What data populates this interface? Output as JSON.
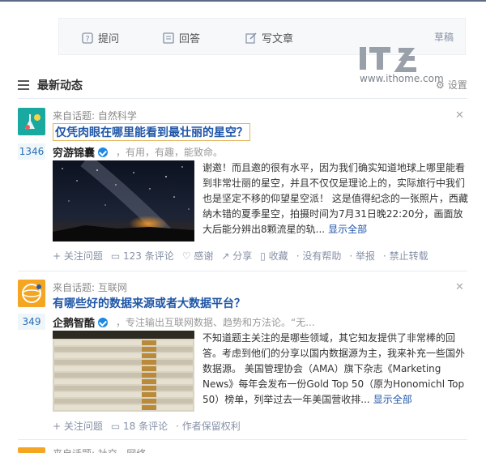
{
  "actionbar": {
    "ask_label": "提问",
    "answer_label": "回答",
    "write_label": "写文章",
    "draft_label": "草稿"
  },
  "watermark": {
    "logo": "IT之家",
    "url": "www.ithome.com"
  },
  "feed": {
    "title": "最新动态",
    "settings_label": "设置"
  },
  "items": [
    {
      "from": "来自话题: 自然科学",
      "title": "仅凭肉眼在哪里能看到最壮丽的星空？",
      "votes": "1346",
      "author": "穷游锦囊",
      "bio": "，有用，有趣，能致命。",
      "excerpt": "谢邀！而且邀的很有水平，因为我们确实知道地球上哪里能看到非常壮丽的星空，并且不仅仅是理论上的，实际旅行中我们也是坚定不移的仰望星空派！ 这是值得纪念的一张照片，西藏纳木错的夏季星空，拍摄时间为7月31日晚22:20分，画面放大后能分辨出8颗流星的轨...",
      "more": "显示全部",
      "actions": [
        "+ 关注问题",
        "123 条评论",
        "感谢",
        "分享",
        "收藏",
        "· 没有帮助",
        "· 举报",
        "· 禁止转载"
      ]
    },
    {
      "from": "来自话题: 互联网",
      "title": "有哪些好的数据来源或者大数据平台？",
      "votes": "349",
      "author": "企鹅智酷",
      "bio": "，专注输出互联网数据、趋势和方法论。“无...",
      "excerpt": "不知道题主关注的是哪些领域，其它知友提供了非常棒的回答。考虑到他们的分享以国内数据源为主，我来补充一些国外数据源。 美国管理协会（AMA）旗下杂志《Marketing News》每年会发布一份Gold Top 50（原为Honomichl Top 50）榜单，列举过去一年美国营收排...",
      "more": "显示全部",
      "actions": [
        "+ 关注问题",
        "18 条评论",
        "· 作者保留权利"
      ]
    }
  ],
  "next_item_from": "来自话题: 社交 · 网络"
}
